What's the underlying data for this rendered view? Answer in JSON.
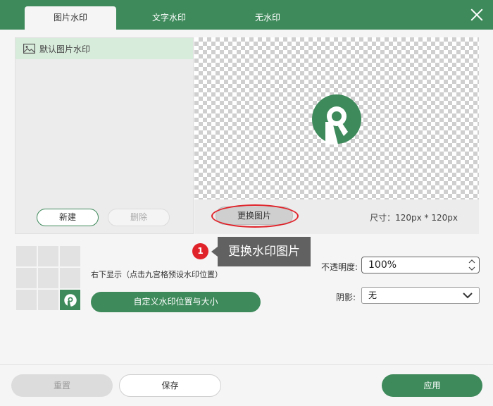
{
  "tabs": [
    {
      "label": "图片水印",
      "active": true
    },
    {
      "label": "文字水印",
      "active": false
    },
    {
      "label": "无水印",
      "active": false
    }
  ],
  "watermark_list": {
    "items": [
      {
        "label": "默认图片水印",
        "icon": "image-icon"
      }
    ],
    "new_label": "新建",
    "delete_label": "删除"
  },
  "preview": {
    "change_label": "更换图片",
    "size_text": "尺寸：120px * 120px"
  },
  "position": {
    "text": "右下显示（点击九宫格预设水印位置）",
    "custom_label": "自定义水印位置与大小",
    "selected_cell": 9
  },
  "callout": {
    "number": "1",
    "text": "更换水印图片"
  },
  "opacity": {
    "label": "不透明度:",
    "value": "100%"
  },
  "shadow": {
    "label": "阴影:",
    "value": "无"
  },
  "footer": {
    "reset_label": "重置",
    "save_label": "保存",
    "apply_label": "应用"
  },
  "colors": {
    "accent": "#3e8a5b",
    "highlight_red": "#e0232a"
  }
}
